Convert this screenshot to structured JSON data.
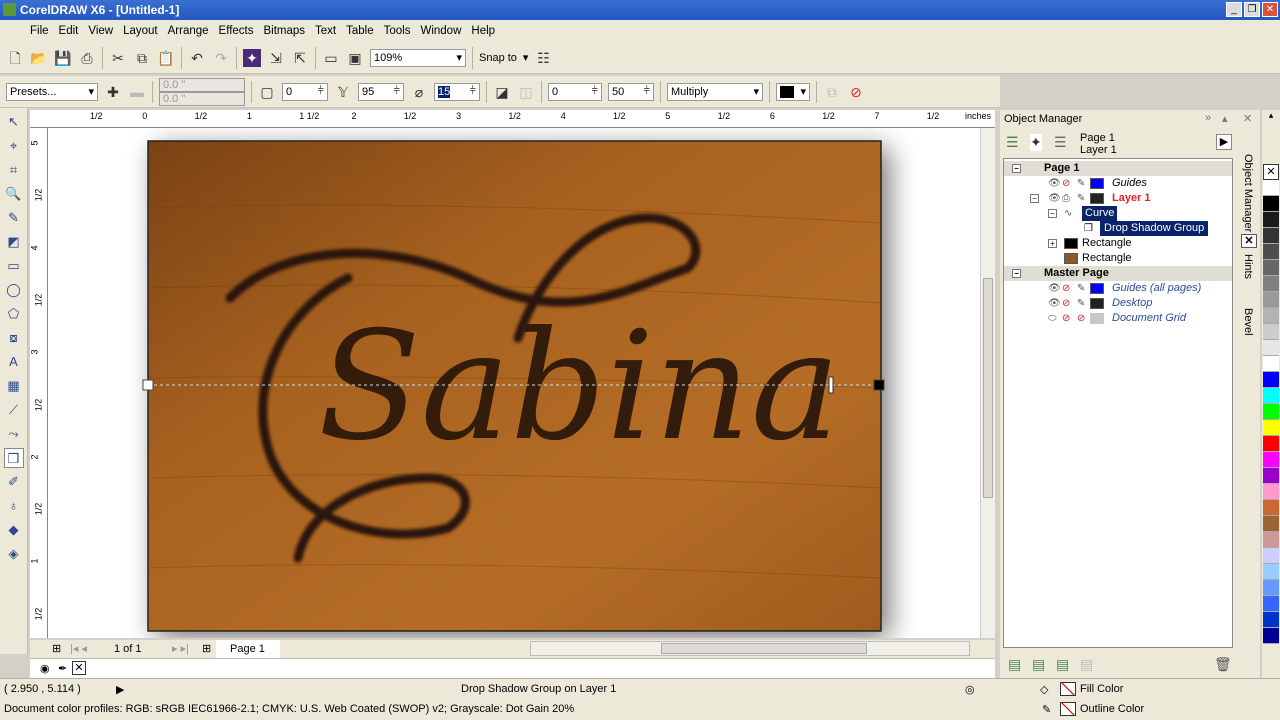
{
  "titlebar": {
    "title": "CorelDRAW X6 - [Untitled-1]"
  },
  "menu": [
    "File",
    "Edit",
    "View",
    "Layout",
    "Arrange",
    "Effects",
    "Bitmaps",
    "Text",
    "Table",
    "Tools",
    "Window",
    "Help"
  ],
  "toolbar": {
    "zoom": "109%",
    "snap_to": "Snap to"
  },
  "propbar": {
    "presets": "Presets...",
    "x_offset": "0.0 \"",
    "y_offset": "0.0 \"",
    "shadow_angle": "0",
    "opacity": "95",
    "feather": "15",
    "fade": "0",
    "stretch": "50",
    "merge_mode": "Multiply"
  },
  "ruler": {
    "units": "inches",
    "top_labels": [
      "1/2",
      "0",
      "1/2",
      "1",
      "1 1/2",
      "2",
      "1/2",
      "3",
      "1/2",
      "4",
      "1/2",
      "5",
      "1/2",
      "6",
      "1/2",
      "7",
      "1/2"
    ],
    "left_labels": [
      "5",
      "1/2",
      "4",
      "1/2",
      "3",
      "1/2",
      "2",
      "1/2",
      "1",
      "1/2"
    ]
  },
  "canvas": {
    "text": "Sabina",
    "wood_color": "#a8621f",
    "text_color": "#2a160a"
  },
  "pagenav": {
    "counter": "1 of 1",
    "page_tab": "Page 1"
  },
  "status": {
    "coords": "( 2.950 , 5.114 )",
    "selection": "Drop Shadow Group on Layer 1",
    "profiles": "Document color profiles: RGB: sRGB IEC61966-2.1; CMYK: U.S. Web Coated (SWOP) v2; Grayscale: Dot Gain 20%",
    "fill_label": "Fill Color",
    "outline_label": "Outline Color"
  },
  "object_manager": {
    "title": "Object Manager",
    "current_page": "Page 1",
    "current_layer": "Layer 1",
    "items": [
      {
        "label": "Page 1",
        "type": "page"
      },
      {
        "label": "Guides",
        "color": "#0000ff",
        "style": "italic"
      },
      {
        "label": "Layer 1",
        "color": "#222222",
        "style": "active"
      },
      {
        "label": "Curve",
        "style": "selected"
      },
      {
        "label": "Drop Shadow Group",
        "style": "selected"
      },
      {
        "label": "Rectangle",
        "color": "#000000"
      },
      {
        "label": "Rectangle",
        "color": "#8b5a2b"
      },
      {
        "label": "Master Page",
        "type": "page"
      },
      {
        "label": "Guides (all pages)",
        "color": "#0000ff",
        "style": "italic"
      },
      {
        "label": "Desktop",
        "color": "#222222",
        "style": "italic"
      },
      {
        "label": "Document Grid",
        "color": "#c8c8c8",
        "style": "italic"
      }
    ]
  },
  "docker_tabs": [
    "Object Manager",
    "Hints",
    "Bevel"
  ],
  "palette": [
    "#ffffff",
    "#000000",
    "#1a1a1a",
    "#333333",
    "#4d4d4d",
    "#666666",
    "#808080",
    "#999999",
    "#b3b3b3",
    "#cccccc",
    "#e6e6e6",
    "#ffffff",
    "#0000ff",
    "#00ffff",
    "#00ff00",
    "#ffff00",
    "#ff0000",
    "#ff00ff",
    "#9900cc",
    "#ff99cc",
    "#cc6633",
    "#996633",
    "#cc9999",
    "#ccccff",
    "#99ccff",
    "#6699ff",
    "#3366ff",
    "#0033cc",
    "#000099"
  ]
}
